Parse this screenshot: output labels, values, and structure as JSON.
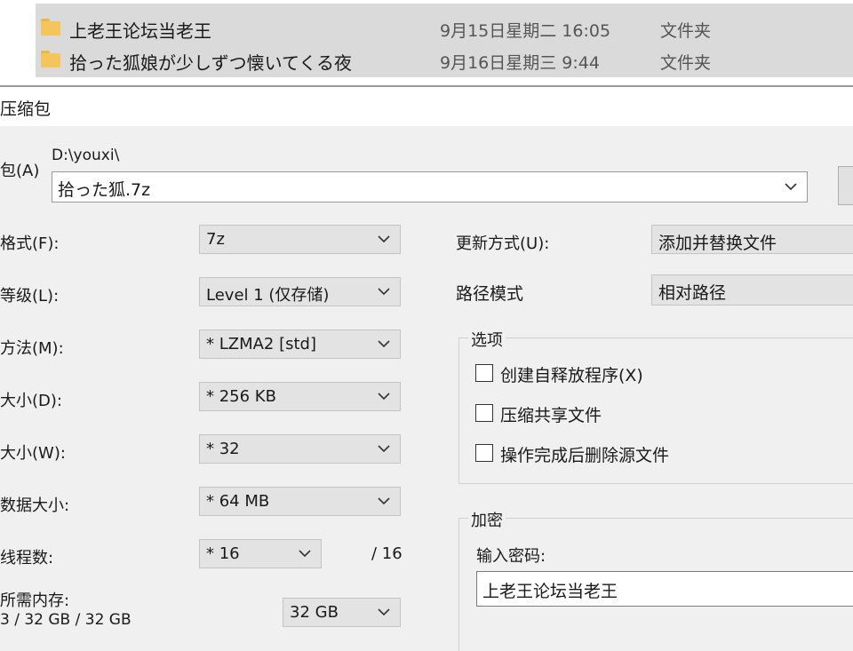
{
  "file_list": {
    "rows": [
      {
        "name": "上老王论坛当老王",
        "date": "9月15日星期二 16:05",
        "type": "文件夹"
      },
      {
        "name": "拾った狐娘が少しずつ懐いてくる夜",
        "date": "9月16日星期三 9:44",
        "type": "文件夹"
      }
    ]
  },
  "dialog": {
    "title": "压缩包",
    "archive": {
      "label": "包(A)",
      "path": "D:\\youxi\\",
      "value": "拾った狐.7z"
    },
    "left_fields": [
      {
        "label": "格式(F):",
        "value": "7z"
      },
      {
        "label": "等级(L):",
        "value": "Level 1 (仅存储)"
      },
      {
        "label": "方法(M):",
        "value": "* LZMA2 [std]"
      },
      {
        "label": "大小(D):",
        "value": "* 256 KB"
      },
      {
        "label": "大小(W):",
        "value": "* 32"
      },
      {
        "label": "数据大小:",
        "value": "* 64 MB"
      }
    ],
    "threads": {
      "label": "线程数:",
      "value": "* 16",
      "max": "/ 16"
    },
    "memory": {
      "label": "所需内存:",
      "info": "3 / 32 GB / 32 GB",
      "value": "32 GB"
    },
    "right_fields": [
      {
        "label": "更新方式(U):",
        "value": "添加并替换文件"
      },
      {
        "label": "路径模式",
        "value": "相对路径"
      }
    ],
    "options": {
      "title": "选项",
      "items": [
        {
          "label": "创建自释放程序(X)",
          "checked": false
        },
        {
          "label": "压缩共享文件",
          "checked": false
        },
        {
          "label": "操作完成后删除源文件",
          "checked": false
        }
      ]
    },
    "encryption": {
      "title": "加密",
      "password_label": "输入密码:",
      "password_value": "上老王论坛当老王"
    }
  },
  "colors": {
    "dialog_bg": "#f0f0f0",
    "select_bg": "#e3e3e3",
    "folder_yellow": "#f4c55a",
    "selection_gray": "#dadada"
  }
}
